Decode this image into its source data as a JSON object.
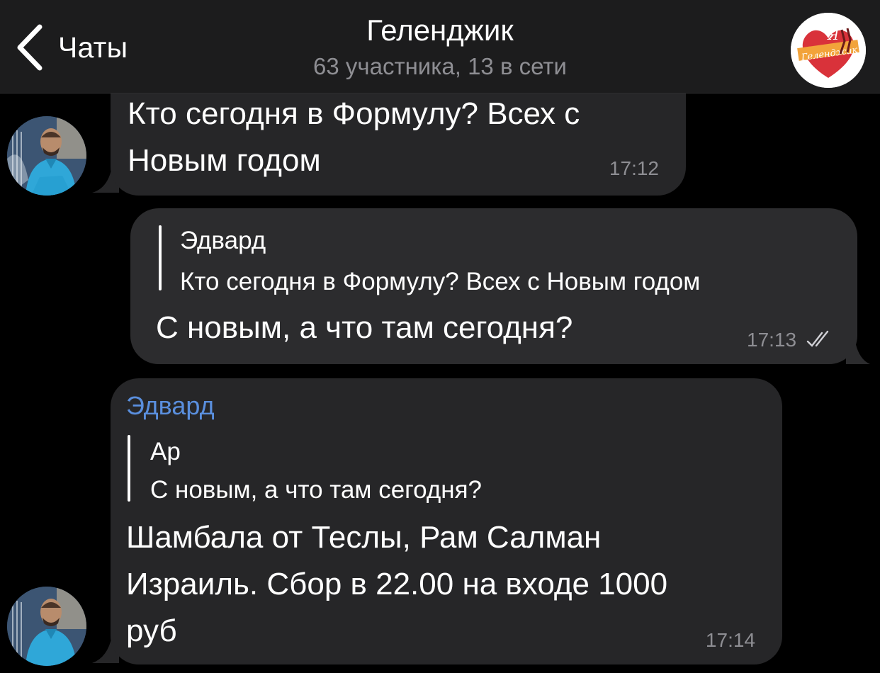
{
  "header": {
    "back_label": "Чаты",
    "title": "Геленджик",
    "subtitle": "63 участника, 13 в сети",
    "avatar_text_top": "Я",
    "avatar_text_bottom": "Геленджик"
  },
  "messages": [
    {
      "direction": "incoming",
      "lines": [
        "Кто сегодня в Формулу? Всех с",
        "Новым годом"
      ],
      "time": "17:12"
    },
    {
      "direction": "outgoing",
      "reply_to": {
        "author": "Эдвард",
        "text": "Кто сегодня в Формулу? Всех с Новым годом"
      },
      "text": "С новым, а что там сегодня?",
      "time": "17:13",
      "status_icon": "double-check-icon"
    },
    {
      "direction": "incoming",
      "sender": "Эдвард",
      "reply_to": {
        "author": "Ар",
        "text": "С новым, а что там сегодня?"
      },
      "lines": [
        "Шамбала от Теслы, Рам Салман",
        "Израиль. Сбор в 22.00 на входе 1000",
        "руб"
      ],
      "time": "17:14"
    }
  ],
  "colors": {
    "background": "#000000",
    "header": "#1c1c1d",
    "incoming_bubble": "#262628",
    "outgoing_bubble": "#2c2c2e",
    "sender_name": "#5a8fde",
    "secondary_text": "#8e8e93"
  }
}
